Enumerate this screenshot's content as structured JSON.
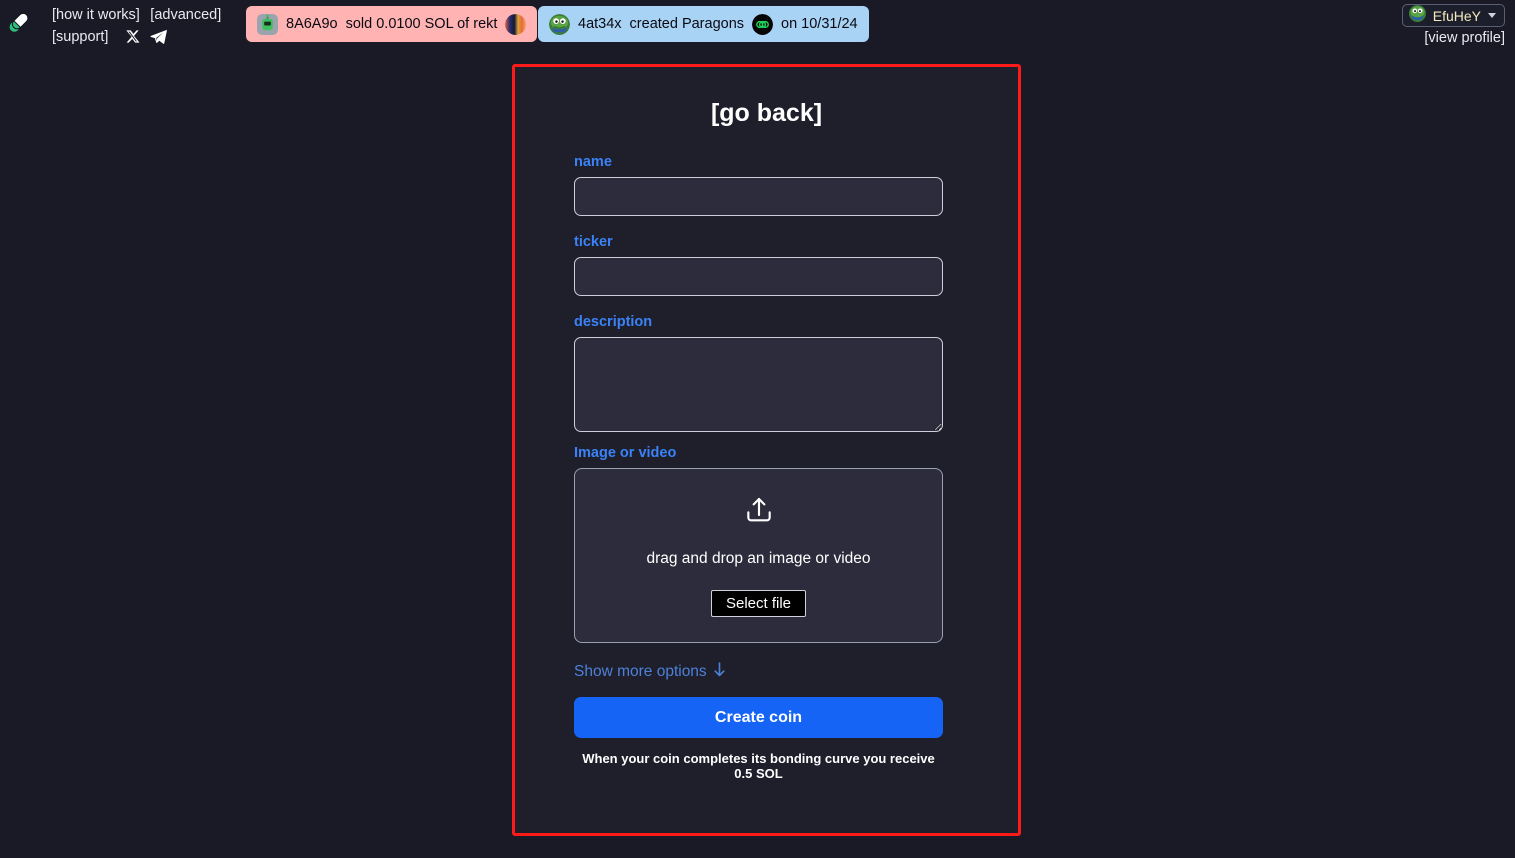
{
  "nav": {
    "logo_icon": "pill-capsule-icon",
    "links": [
      {
        "label": "[how it works]"
      },
      {
        "label": "[advanced]"
      },
      {
        "label": "[support]"
      }
    ],
    "social": [
      {
        "icon": "x-twitter-icon"
      },
      {
        "icon": "telegram-icon"
      }
    ]
  },
  "banners": [
    {
      "avatar_icon": "robot-avatar-icon",
      "user": "8A6A9o",
      "text": "sold 0.0100 SOL of rekt",
      "coin_icon": "coin-thumbnail-icon",
      "bg": "#ffb3b3"
    },
    {
      "avatar_icon": "pepe-avatar-icon",
      "user": "4at34x",
      "text": "created Paragons",
      "coin_icon": "coin-thumbnail-icon",
      "suffix": "on 10/31/24",
      "bg": "#a9d3f5"
    }
  ],
  "profile": {
    "avatar_icon": "pepe-avatar-icon",
    "username": "EfuHeY",
    "caret_icon": "chevron-down-icon",
    "view_profile_label": "[view profile]"
  },
  "card": {
    "border_color": "#ff1a1a",
    "go_back_label": "[go back]",
    "fields": {
      "name": {
        "label": "name",
        "value": "",
        "placeholder": ""
      },
      "ticker": {
        "label": "ticker",
        "value": "",
        "placeholder": ""
      },
      "description": {
        "label": "description",
        "value": "",
        "placeholder": ""
      },
      "media": {
        "label": "Image or video"
      }
    },
    "dropzone": {
      "upload_icon": "upload-icon",
      "text": "drag and drop an image or video",
      "select_file_label": "Select file"
    },
    "show_more_label": "Show more options",
    "show_more_icon": "arrow-down-icon",
    "create_coin_label": "Create coin",
    "bonding_note": "When your coin completes its bonding curve you receive 0.5 SOL",
    "accent_color": "#1664f6",
    "label_color": "#3b82f6"
  }
}
